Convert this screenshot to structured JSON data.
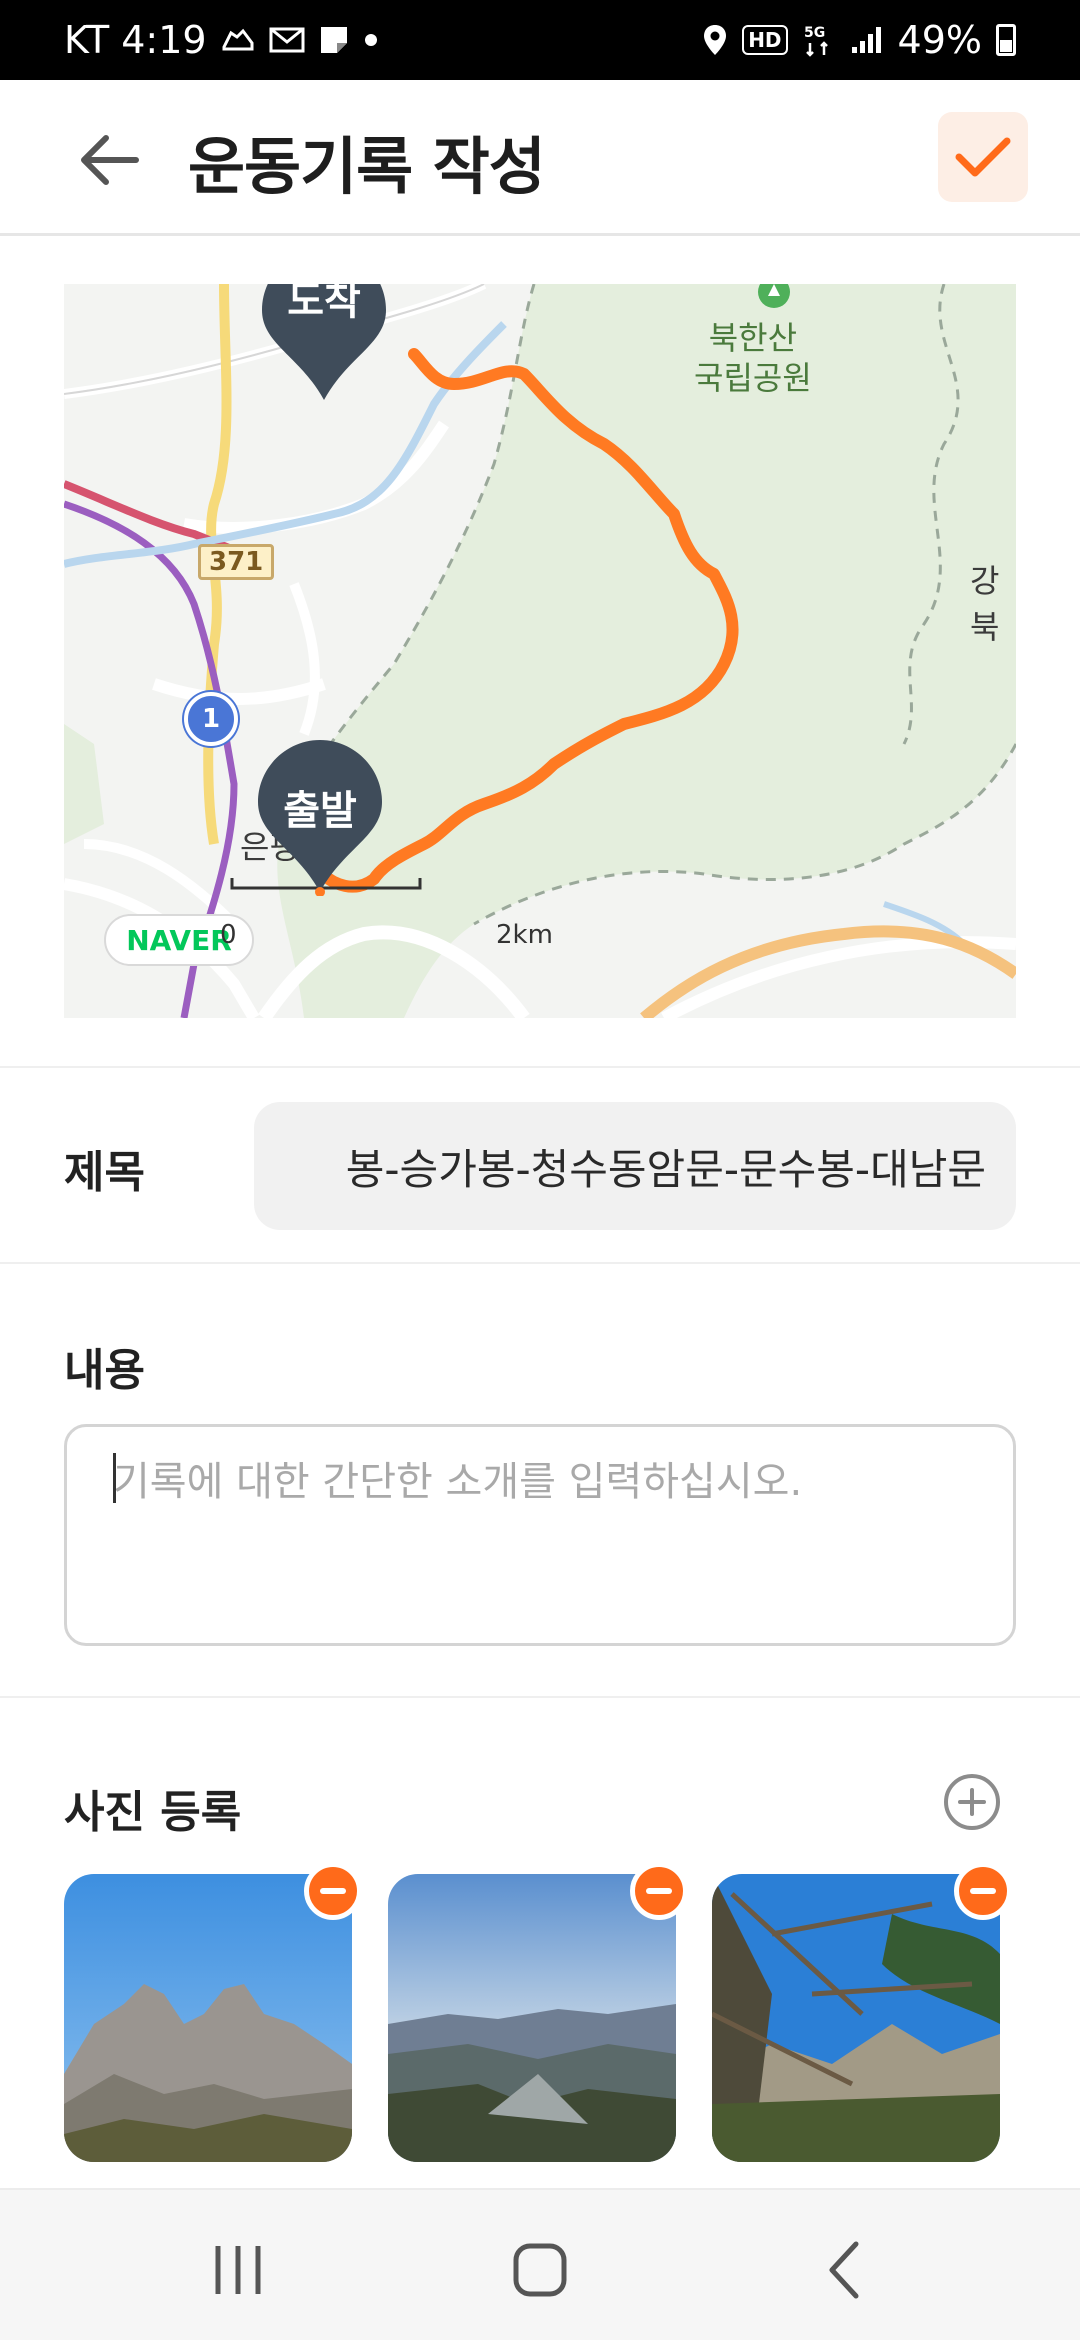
{
  "status_bar": {
    "carrier_time": "KT 4:19",
    "right_text": "49%",
    "icons": [
      "sneaker-icon",
      "mail-icon",
      "note-icon",
      "dot-icon",
      "location-icon",
      "hd-icon",
      "5g-icon",
      "signal-icon",
      "battery-icon"
    ]
  },
  "header": {
    "title": "운동기록 작성",
    "back_icon": "arrow-left-icon",
    "confirm_icon": "check-icon",
    "accent_color": "#ff6a1a"
  },
  "map": {
    "arrival_label": "도착",
    "departure_label": "출발",
    "park_name_line1": "북한산",
    "park_name_line2": "국립공원",
    "route_number": "371",
    "highway_number": "1",
    "right_label": "강북",
    "left_area_label": "은평",
    "provider": "NAVER",
    "scale_start": "0",
    "scale_end": "2km",
    "route_color": "#ff7a22",
    "park_color": "#e4eedd"
  },
  "form": {
    "title_label": "제목",
    "title_value": "봉-승가봉-청수동암문-문수봉-대남문",
    "content_label": "내용",
    "content_placeholder": "기록에 대한 간단한 소개를 입력하십시오.",
    "photo_label": "사진 등록",
    "photos": [
      {
        "alt": "mountain-peaks-photo"
      },
      {
        "alt": "valley-view-photo"
      },
      {
        "alt": "pine-tree-photo"
      }
    ]
  },
  "nav": {
    "icons": [
      "recent-apps-icon",
      "home-icon",
      "back-icon"
    ]
  }
}
